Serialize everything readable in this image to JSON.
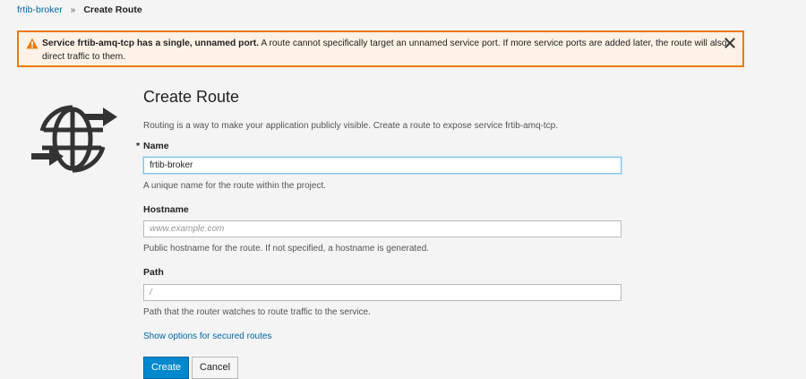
{
  "breadcrumb": {
    "parent": "frtib-broker",
    "separator": "»",
    "current": "Create Route"
  },
  "alert": {
    "title": "Service frtib-amq-tcp has a single, unnamed port.",
    "message": "A route cannot specifically target an unnamed service port. If more service ports are added later, the route will also direct traffic to them.",
    "icon": "warning-triangle-icon",
    "close_icon": "close-icon",
    "border_color": "#ec7a08"
  },
  "page": {
    "title": "Create Route",
    "intro": "Routing is a way to make your application publicly visible. Create a route to expose service frtib-amq-tcp.",
    "icon": "route-globe-icon"
  },
  "form": {
    "name": {
      "required_mark": "*",
      "label": "Name",
      "value": "frtib-broker",
      "help": "A unique name for the route within the project."
    },
    "hostname": {
      "label": "Hostname",
      "placeholder": "www.example.com",
      "help": "Public hostname for the route. If not specified, a hostname is generated."
    },
    "path": {
      "label": "Path",
      "placeholder": "/",
      "help": "Path that the router watches to route traffic to the service."
    },
    "secured_link": "Show options for secured routes"
  },
  "buttons": {
    "create": "Create",
    "cancel": "Cancel"
  },
  "colors": {
    "primary": "#0088ce",
    "link": "#0066a4"
  }
}
